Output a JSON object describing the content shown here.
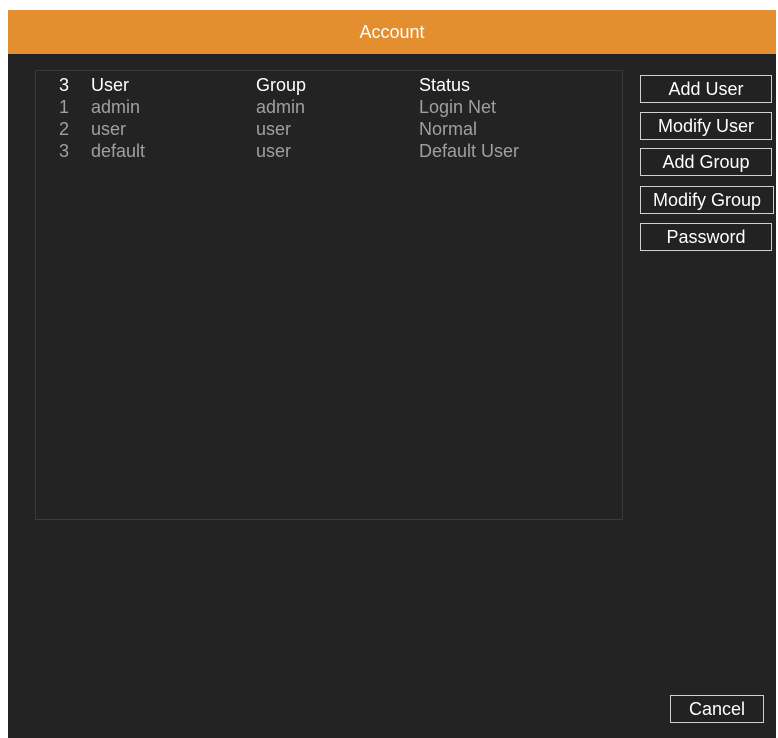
{
  "window": {
    "title": "Account"
  },
  "accent_color": "#e38e2f",
  "user_list": {
    "header": {
      "count": "3",
      "user": "User",
      "group": "Group",
      "status": "Status"
    },
    "rows": [
      {
        "index": "1",
        "user": "admin",
        "group": "admin",
        "status": "Login Net"
      },
      {
        "index": "2",
        "user": "user",
        "group": "user",
        "status": "Normal"
      },
      {
        "index": "3",
        "user": "default",
        "group": "user",
        "status": "Default User"
      }
    ]
  },
  "buttons": {
    "add_user": "Add User",
    "modify_user": "Modify User",
    "add_group": "Add Group",
    "modify_group": "Modify Group",
    "password": "Password",
    "cancel": "Cancel"
  }
}
